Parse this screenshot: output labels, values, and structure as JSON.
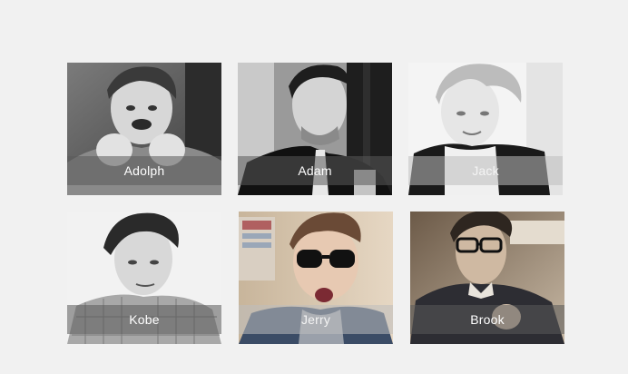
{
  "gallery": {
    "items": [
      {
        "name": "Adolph"
      },
      {
        "name": "Adam"
      },
      {
        "name": "Jack"
      },
      {
        "name": "Kobe"
      },
      {
        "name": "Jerry"
      },
      {
        "name": "Brook"
      }
    ]
  },
  "colors": {
    "page_background": "#f1f1f1",
    "caption_text": "#ffffff",
    "caption_overlay": "rgba(90,90,90,0.55)"
  }
}
